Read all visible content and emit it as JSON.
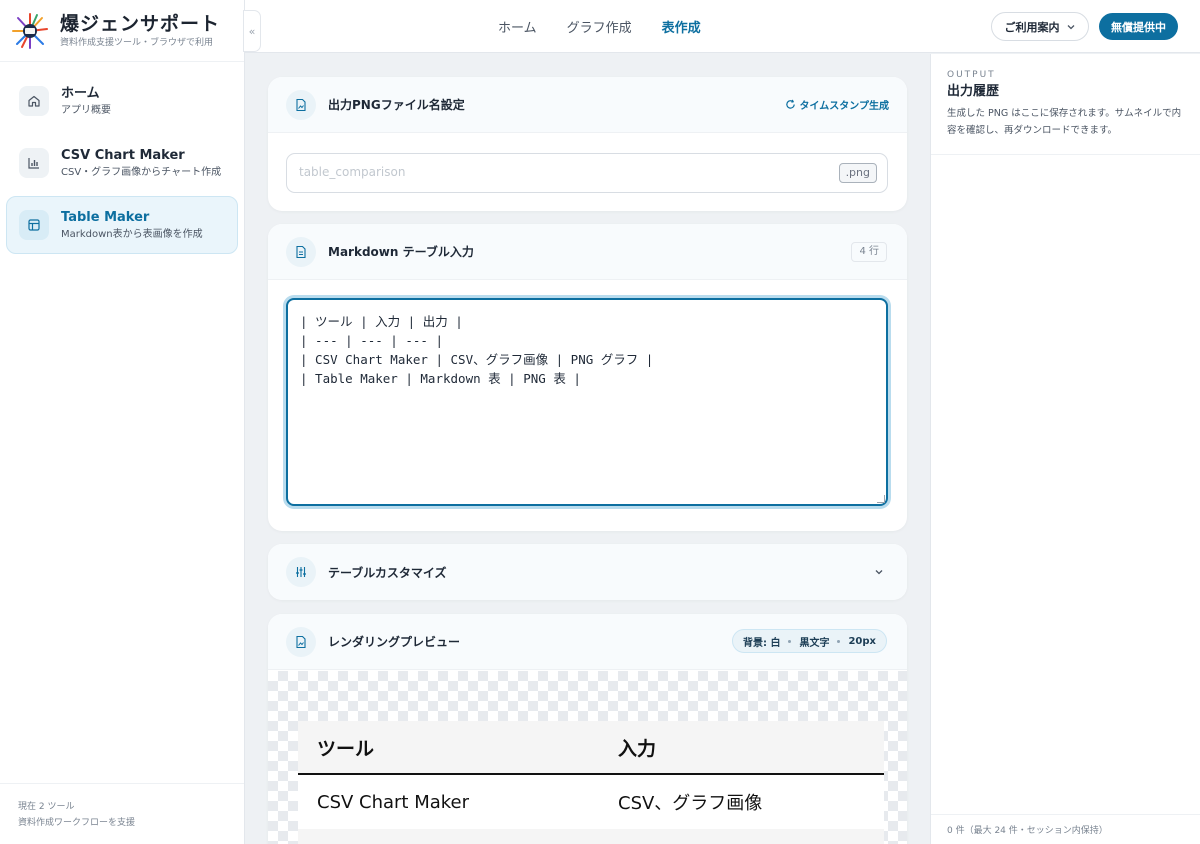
{
  "brand": {
    "title": "爆ジェンサポート",
    "subtitle": "資料作成支援ツール・ブラウザで利用",
    "collapse_glyph": "«"
  },
  "sidebar": {
    "items": [
      {
        "title": "ホーム",
        "desc": "アプリ概要",
        "icon": "home-icon"
      },
      {
        "title": "CSV Chart Maker",
        "desc": "CSV・グラフ画像からチャート作成",
        "icon": "bar-chart-icon"
      },
      {
        "title": "Table Maker",
        "desc": "Markdown表から表画像を作成",
        "icon": "table-icon"
      }
    ],
    "footer_line1": "現在 2 ツール",
    "footer_line2": "資料作成ワークフローを支援"
  },
  "topbar": {
    "tabs": [
      "ホーム",
      "グラフ作成",
      "表作成"
    ],
    "active_tab": "表作成",
    "guide_label": "ご利用案内",
    "free_label": "無償提供中"
  },
  "filename_card": {
    "title": "出力PNGファイル名設定",
    "timestamp_label": "タイムスタンプ生成",
    "placeholder": "table_comparison",
    "extension": ".png"
  },
  "markdown_card": {
    "title": "Markdown テーブル入力",
    "rows_badge": "4 行",
    "content": "| ツール | 入力 | 出力 |\n| --- | --- | --- |\n| CSV Chart Maker | CSV、グラフ画像 | PNG グラフ |\n| Table Maker | Markdown 表 | PNG 表 |"
  },
  "customize_card": {
    "title": "テーブルカスタマイズ"
  },
  "preview_card": {
    "title": "レンダリングプレビュー",
    "opt_bg": "背景: 白",
    "opt_text": "黒文字",
    "opt_size": "20px",
    "header": [
      "ツール",
      "入力"
    ],
    "row1": [
      "CSV Chart Maker",
      "CSV、グラフ画像"
    ]
  },
  "output_panel": {
    "eyebrow": "OUTPUT",
    "title": "出力履歴",
    "desc": "生成した PNG はここに保存されます。サムネイルで内容を確認し、再ダウンロードできます。",
    "footer": "0 件（最大 24 件・セッション内保持）"
  },
  "colors": {
    "accent": "#0d6fa0",
    "page_bg": "#eef1f4"
  }
}
